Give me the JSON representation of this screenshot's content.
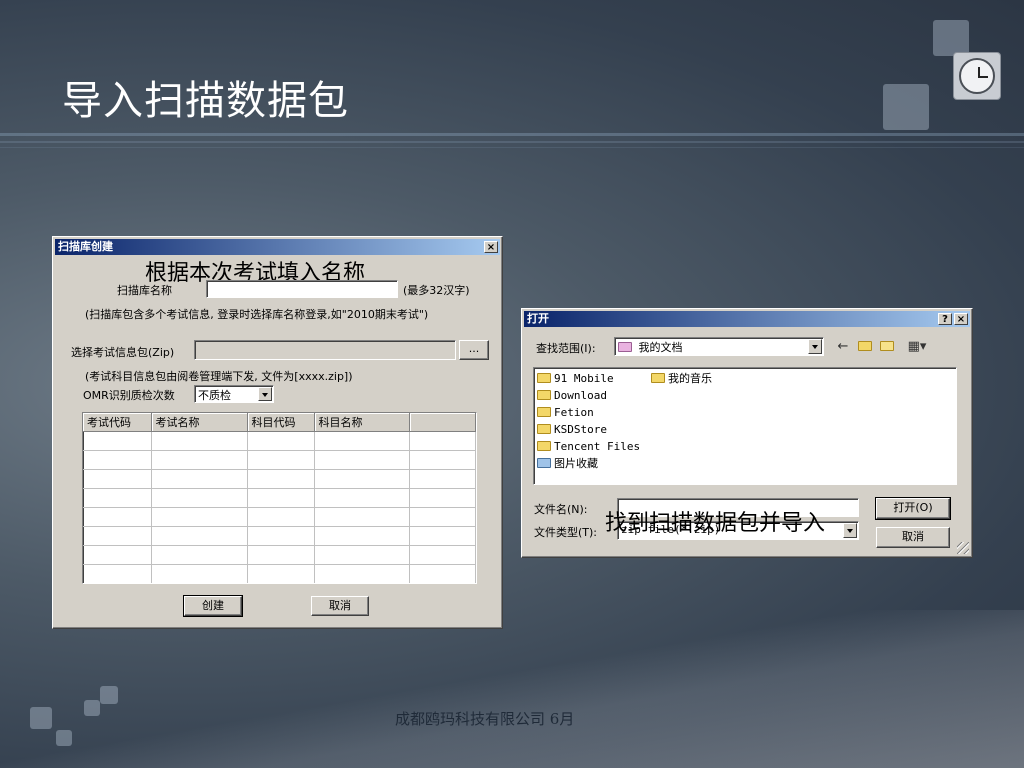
{
  "slide": {
    "title": "导入扫描数据包",
    "footer": "成都鸥玛科技有限公司 6月"
  },
  "dialog_create": {
    "title": "扫描库创建",
    "annotation": "根据本次考试填入名称",
    "name_label": "扫描库名称",
    "name_value": "",
    "name_hint": "(最多32汉字)",
    "name_note": "(扫描库包含多个考试信息, 登录时选择库名称登录,如\"2010期末考试\")",
    "package_label": "选择考试信息包(Zip)",
    "package_value": "",
    "browse_label": "...",
    "package_note": "(考试科目信息包由阅卷管理端下发, 文件为[xxxx.zip])",
    "omr_label": "OMR识别质检次数",
    "omr_value": "不质检",
    "columns": [
      "考试代码",
      "考试名称",
      "科目代码",
      "科目名称",
      ""
    ],
    "create_label": "创建",
    "cancel_label": "取消"
  },
  "dialog_open": {
    "title": "打开",
    "help_label": "?",
    "close_label": "×",
    "lookin_label": "查找范围(I):",
    "lookin_value": "我的文档",
    "files": [
      {
        "name": "91 Mobile",
        "kind": "folder"
      },
      {
        "name": "Download",
        "kind": "folder"
      },
      {
        "name": "Fetion",
        "kind": "folder"
      },
      {
        "name": "KSDStore",
        "kind": "folder"
      },
      {
        "name": "Tencent Files",
        "kind": "folder"
      },
      {
        "name": "图片收藏",
        "kind": "pictures"
      },
      {
        "name": "我的音乐",
        "kind": "music"
      }
    ],
    "filename_label": "文件名(N):",
    "filename_value": "",
    "filetype_label": "文件类型(T):",
    "filetype_value": "zip file(*.zip)",
    "annotation": "找到扫描数据包并导入",
    "open_label": "打开(O)",
    "cancel_label": "取消"
  },
  "icons": [
    "back-arrow-icon",
    "up-folder-icon",
    "new-folder-icon",
    "view-menu-icon",
    "clock-icon",
    "folder-icon"
  ]
}
